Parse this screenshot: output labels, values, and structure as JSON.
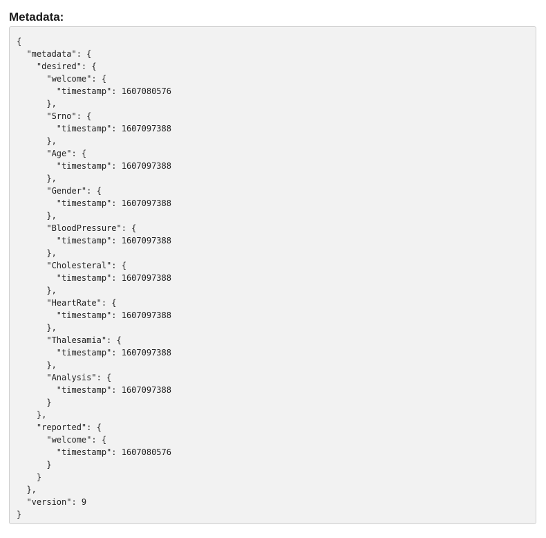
{
  "section": {
    "title": "Metadata:"
  },
  "code": {
    "lines": [
      "{",
      "  \"metadata\": {",
      "    \"desired\": {",
      "      \"welcome\": {",
      "        \"timestamp\": 1607080576",
      "      },",
      "      \"Srno\": {",
      "        \"timestamp\": 1607097388",
      "      },",
      "      \"Age\": {",
      "        \"timestamp\": 1607097388",
      "      },",
      "      \"Gender\": {",
      "        \"timestamp\": 1607097388",
      "      },",
      "      \"BloodPressure\": {",
      "        \"timestamp\": 1607097388",
      "      },",
      "      \"Cholesteral\": {",
      "        \"timestamp\": 1607097388",
      "      },",
      "      \"HeartRate\": {",
      "        \"timestamp\": 1607097388",
      "      },",
      "      \"Thalesamia\": {",
      "        \"timestamp\": 1607097388",
      "      },",
      "      \"Analysis\": {",
      "        \"timestamp\": 1607097388",
      "      }",
      "    },",
      "    \"reported\": {",
      "      \"welcome\": {",
      "        \"timestamp\": 1607080576",
      "      }",
      "    }",
      "  },",
      "  \"version\": 9",
      "}"
    ]
  }
}
